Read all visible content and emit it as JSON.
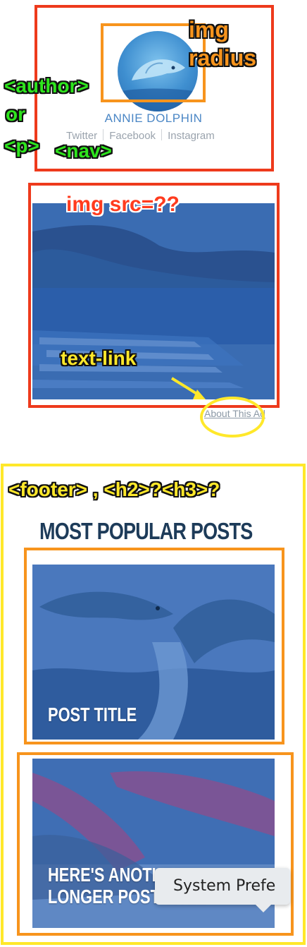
{
  "annotations": {
    "img_radius": [
      "img",
      "radius"
    ],
    "author_or_p": [
      "<author>",
      "or",
      "<p>"
    ],
    "nav": "<nav>",
    "img_src": "img src=??",
    "text_link": "text-link",
    "footer_headings": "<footer> , <h2>?<h3>?"
  },
  "author": {
    "name": "ANNIE DOLPHIN",
    "links": [
      "Twitter",
      "Facebook",
      "Instagram"
    ]
  },
  "ad": {
    "about_link": "About This Ad"
  },
  "footer": {
    "heading": "MOST POPULAR POSTS",
    "posts": [
      {
        "title_lines": [
          "POST TITLE"
        ]
      },
      {
        "title_lines": [
          "HERE'S ANOTHER",
          "LONGER POST TITLE"
        ]
      }
    ]
  },
  "tooltip": {
    "text": "System Prefe"
  },
  "colors": {
    "red_box": "#ee3a1c",
    "orange_box": "#f7941d",
    "yellow_box": "#ffe82a",
    "green_label": "#2ee51d",
    "author_name": "#4a86c5",
    "heading": "#1d3b59"
  }
}
